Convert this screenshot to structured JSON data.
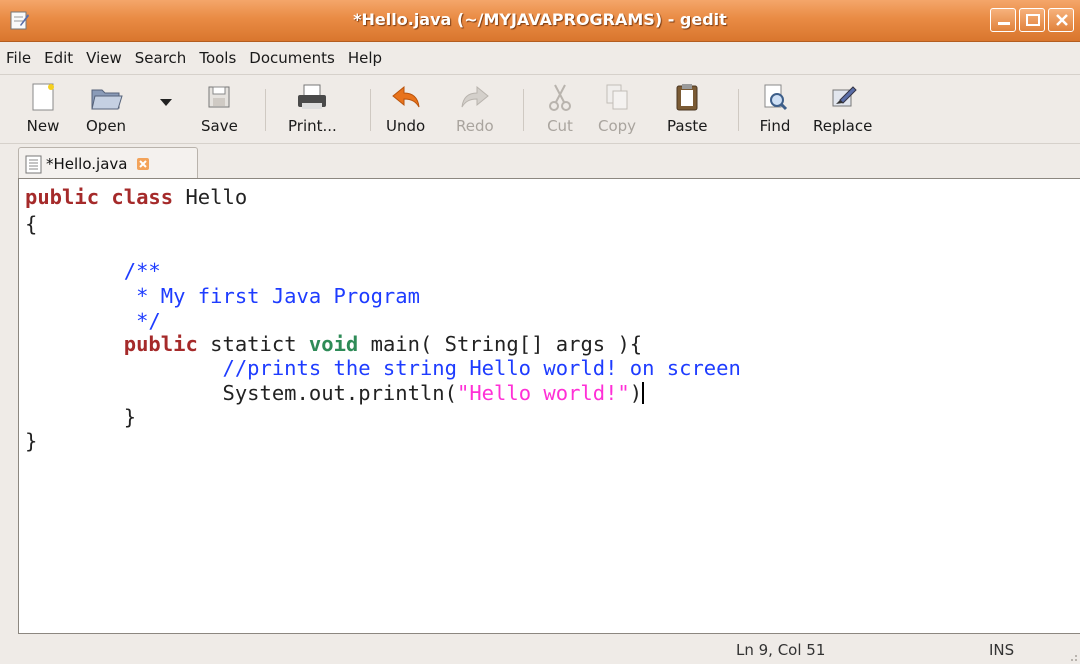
{
  "window": {
    "title": "*Hello.java (~/MYJAVAPROGRAMS) - gedit",
    "accent": "#e98b44"
  },
  "menu": [
    "File",
    "Edit",
    "View",
    "Search",
    "Tools",
    "Documents",
    "Help"
  ],
  "toolbar": {
    "new": "New",
    "open": "Open",
    "save": "Save",
    "print": "Print...",
    "undo": "Undo",
    "redo": "Redo",
    "cut": "Cut",
    "copy": "Copy",
    "paste": "Paste",
    "find": "Find",
    "replace": "Replace"
  },
  "tab": {
    "label": "*Hello.java"
  },
  "code": {
    "l1_kw": "public class",
    "l1_rest": " Hello",
    "l2": "{",
    "l4": "        /**",
    "l5": "         * My first Java Program",
    "l6": "         */",
    "l7_indent": "        ",
    "l7_kw1": "public",
    "l7_mid": " statict ",
    "l7_kw2": "void",
    "l7_rest": " main( String[] args ){",
    "l8": "                //prints the string Hello world! on screen",
    "l9_pre": "                System.out.println(",
    "l9_str": "\"Hello world!\"",
    "l9_post": ")",
    "l10": "        }",
    "l11": "}"
  },
  "status": {
    "position": "Ln 9, Col 51",
    "mode": "INS"
  }
}
